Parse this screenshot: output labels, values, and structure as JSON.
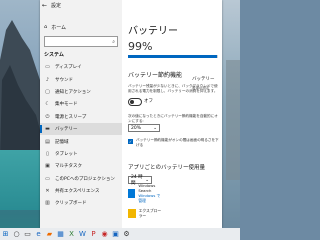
{
  "window": {
    "title": "設定",
    "home_label": "ホーム",
    "search_placeholder": "設定の検索",
    "section_label": "システム"
  },
  "nav_items": [
    {
      "label": "ディスプレイ",
      "icon": "display-icon"
    },
    {
      "label": "サウンド",
      "icon": "sound-icon"
    },
    {
      "label": "通知とアクション",
      "icon": "notifications-icon"
    },
    {
      "label": "集中モード",
      "icon": "focus-assist-icon"
    },
    {
      "label": "電源とスリープ",
      "icon": "power-icon"
    },
    {
      "label": "バッテリー",
      "icon": "battery-icon",
      "selected": true
    },
    {
      "label": "記憶域",
      "icon": "storage-icon"
    },
    {
      "label": "タブレット",
      "icon": "tablet-icon"
    },
    {
      "label": "マルチタスク",
      "icon": "multitasking-icon"
    },
    {
      "label": "このPCへのプロジェクション",
      "icon": "projection-icon"
    },
    {
      "label": "共有エクスペリエンス",
      "icon": "shared-experiences-icon"
    },
    {
      "label": "クリップボード",
      "icon": "clipboard-icon"
    }
  ],
  "content": {
    "title": "バッテリー",
    "percentage_text": "99%",
    "percentage_value": 99,
    "saver_heading": "バッテリー節約機能",
    "saver_description": "バッテリー残量が少ないときに、バックグラウンドで使用される電力を制限し、バッテリーの消費を抑えます。",
    "saver_toggle_label": "オフ",
    "auto_label": "次の値になったときにバッテリー節約機能を自動的にオンにする:",
    "auto_value": "20%",
    "brightness_label": "バッテリー節約機能がオンの間は画面の明るさを下げる",
    "apps_heading": "アプリごとのバッテリー使用量",
    "period_value": "24 時間",
    "apps": [
      {
        "name": "Windows Search",
        "sub": "Windows で管理"
      },
      {
        "name": "エクスプローラー",
        "sub": ""
      }
    ],
    "right_heading": "バッテリー",
    "right_text": "電源の設定"
  },
  "taskbar": {
    "items": [
      "start-icon",
      "search-icon",
      "task-view-icon",
      "edge-icon",
      "explorer-icon",
      "store-icon",
      "excel-icon",
      "word-icon",
      "powerpoint-icon",
      "chrome-icon",
      "photos-icon",
      "settings-icon"
    ]
  },
  "colors": {
    "accent": "#0067c0",
    "taskbar": "#e9ecef",
    "nav_bg": "#f2f2f2"
  }
}
